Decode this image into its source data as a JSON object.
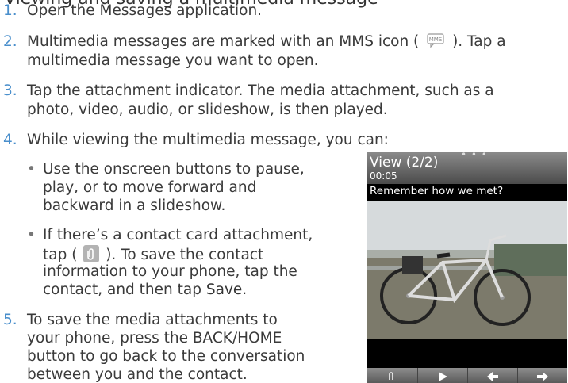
{
  "heading": "Viewing and saving a multimedia message",
  "steps": [
    {
      "num": "1.",
      "lines": [
        "Open the Messages application."
      ]
    },
    {
      "num": "2.",
      "lines_a": "Multimedia messages are marked with an MMS icon (",
      "lines_b": "). Tap a",
      "line2": "multimedia message you want to open."
    },
    {
      "num": "3.",
      "lines": [
        "Tap the attachment indicator. The media attachment, such as a",
        "photo, video, audio, or slideshow, is then played."
      ]
    },
    {
      "num": "4.",
      "lines": [
        "While viewing the multimedia message, you can:"
      ]
    },
    {
      "num": "5.",
      "lines": [
        "To save the media attachments to",
        "your phone, press the BACK/HOME",
        "button to go back to the conversation",
        "between you and the contact."
      ]
    }
  ],
  "bullets": [
    {
      "lines": [
        "Use the onscreen buttons to pause,",
        "play, or to move forward and",
        "backward in a slideshow."
      ]
    },
    {
      "l1": "If there’s a contact card attachment,",
      "l2a": "tap (",
      "l2b": "). To save the contact",
      "l3": "information to your phone, tap the",
      "l4a": "contact, and then tap ",
      "l4b": "Save."
    }
  ],
  "phone": {
    "title": "View (2/2)",
    "time": "00:05",
    "subject": "Remember how we met?",
    "dots": "• • •"
  },
  "icons": {
    "mms": "mms-icon",
    "attachment": "paperclip-icon",
    "toolbar": [
      "paperclip-icon",
      "play-icon",
      "previous-icon",
      "next-icon"
    ]
  },
  "colors": {
    "step_number": "#4a8fcc",
    "text": "#3a3a3a"
  }
}
